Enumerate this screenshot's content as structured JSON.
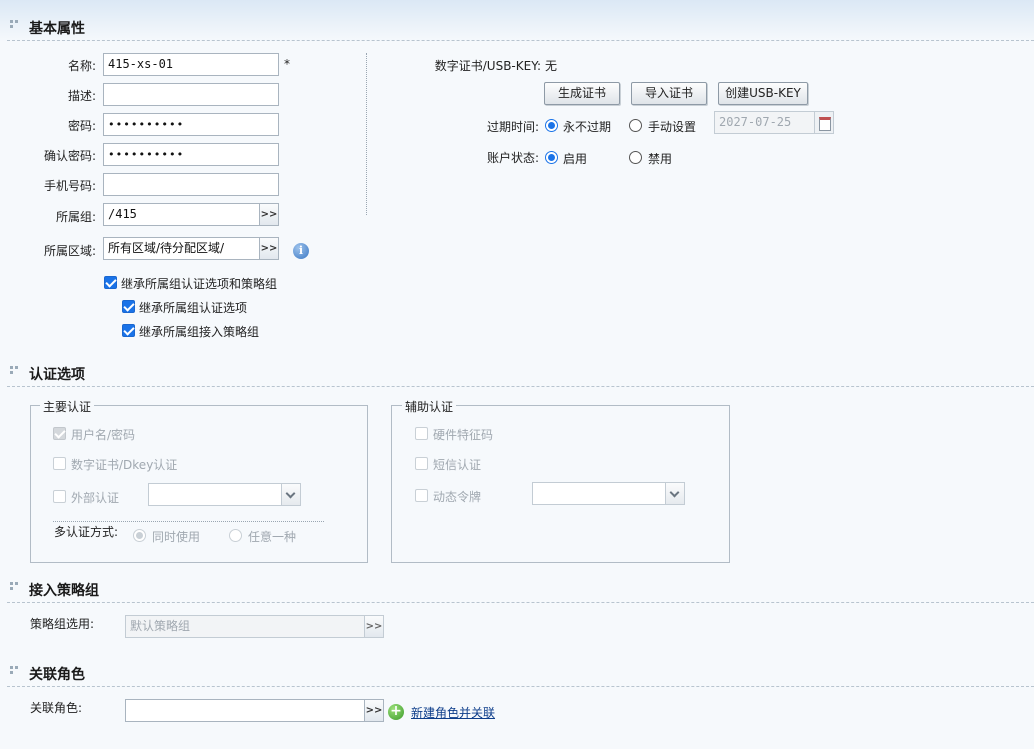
{
  "basic": {
    "section_title": "基本属性",
    "name_label": "名称:",
    "name_value": "415-xs-01",
    "required_mark": "*",
    "desc_label": "描述:",
    "desc_value": "",
    "password_label": "密码:",
    "password_value": "••••••••••",
    "confirm_label": "确认密码:",
    "confirm_value": "••••••••••",
    "phone_label": "手机号码:",
    "phone_value": "",
    "group_label": "所属组:",
    "group_value": "/415",
    "region_label": "所属区域:",
    "region_value": "所有区域/待分配区域/",
    "inherit_all": "继承所属组认证选项和策略组",
    "inherit_auth": "继承所属组认证选项",
    "inherit_policy": "继承所属组接入策略组",
    "cert_label": "数字证书/USB-KEY:",
    "cert_value": "无",
    "gen_cert_btn": "生成证书",
    "import_cert_btn": "导入证书",
    "create_usbkey_btn": "创建USB-KEY",
    "expire_label": "过期时间:",
    "expire_never": "永不过期",
    "expire_manual": "手动设置",
    "expire_date": "2027-07-25",
    "status_label": "账户状态:",
    "status_enable": "启用",
    "status_disable": "禁用"
  },
  "auth": {
    "section_title": "认证选项",
    "primary_legend": "主要认证",
    "user_pass": "用户名/密码",
    "digital_cert": "数字证书/Dkey认证",
    "external": "外部认证",
    "multi_label": "多认证方式:",
    "multi_all": "同时使用",
    "multi_any": "任意一种",
    "aux_legend": "辅助认证",
    "hardware": "硬件特征码",
    "sms": "短信认证",
    "token": "动态令牌"
  },
  "policy": {
    "section_title": "接入策略组",
    "label": "策略组选用:",
    "value": "默认策略组"
  },
  "role": {
    "section_title": "关联角色",
    "label": "关联角色:",
    "value": "",
    "new_link": "新建角色并关联"
  },
  "colors": {
    "accent": "#1a73e8",
    "link": "#0d3d8a"
  }
}
